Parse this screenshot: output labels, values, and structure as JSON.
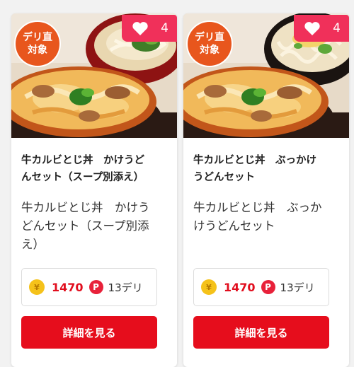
{
  "cards": [
    {
      "badge_line1": "デリ直",
      "badge_line2": "対象",
      "favorite_count": "4",
      "name_line1": "牛カルビとじ丼　かけうど",
      "name_line2": "んセット（スープ別添え）",
      "desc_line1": "牛カルビとじ丼　かけう",
      "desc_line2": "どんセット（スープ別添",
      "desc_line3": "え）",
      "yen_symbol": "¥",
      "price": "1470",
      "point_symbol": "P",
      "points": "13デリ",
      "button_label": "詳細を見る"
    },
    {
      "badge_line1": "デリ直",
      "badge_line2": "対象",
      "favorite_count": "4",
      "name_line1": "牛カルビとじ丼　ぶっかけ",
      "name_line2": "うどんセット",
      "desc_line1": "牛カルビとじ丼　ぶっか",
      "desc_line2": "けうどんセット",
      "desc_line3": "",
      "yen_symbol": "¥",
      "price": "1470",
      "point_symbol": "P",
      "points": "13デリ",
      "button_label": "詳細を見る"
    }
  ],
  "colors": {
    "badge_orange": "#e8561d",
    "favorite_pink": "#f0305a",
    "price_red": "#e10e1e",
    "button_red": "#e60d1c",
    "coin_gold": "#f5c21a"
  }
}
